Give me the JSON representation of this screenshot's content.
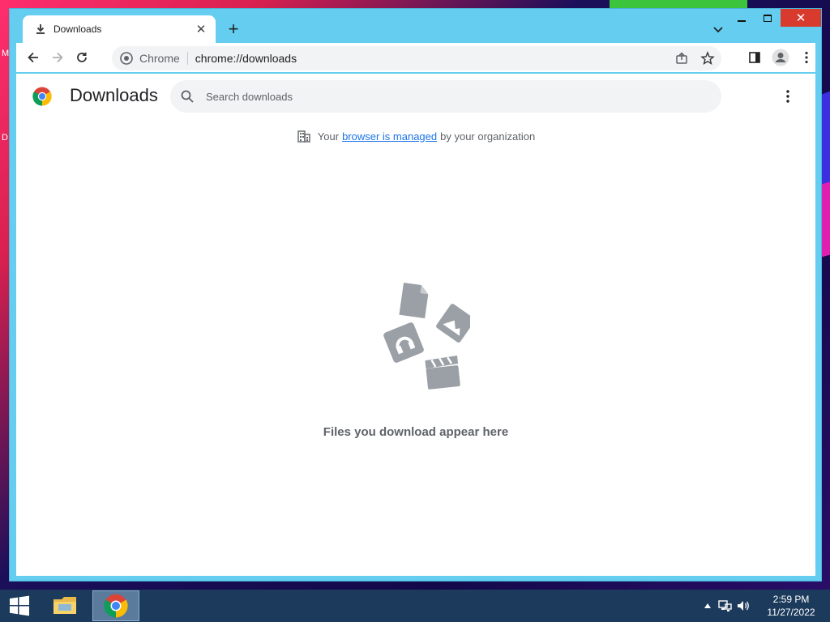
{
  "desktop": {
    "edge_text_top": "M",
    "edge_text_bottom": "D"
  },
  "tab": {
    "title": "Downloads",
    "close_icon": "close-icon",
    "new_tab_icon": "plus-icon"
  },
  "omnibox": {
    "site": "Chrome",
    "url": "chrome://downloads"
  },
  "page": {
    "title": "Downloads",
    "search_placeholder": "Search downloads",
    "managed_prefix": "Your",
    "managed_link": "browser is managed",
    "managed_suffix": "by your organization",
    "empty_message": "Files you download appear here"
  },
  "taskbar": {
    "time": "2:59 PM",
    "date": "11/27/2022"
  },
  "colors": {
    "titlebar": "#64cdf0",
    "close": "#d83a2e",
    "link": "#1a73e8",
    "taskbar": "#1c3a5c"
  }
}
